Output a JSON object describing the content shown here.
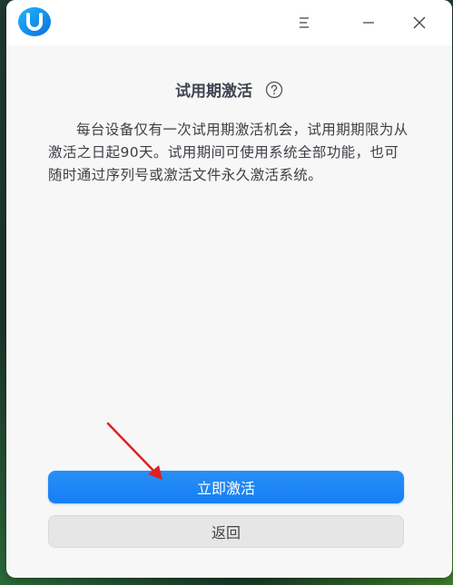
{
  "titlebar": {
    "app_icon": "uos-logo-icon",
    "menu_icon": "menu-icon",
    "minimize_icon": "minimize-icon",
    "close_icon": "close-icon"
  },
  "dialog": {
    "title": "试用期激活",
    "help_icon": "help-icon",
    "description": "每台设备仅有一次试用期激活机会，试用期期限为从激活之日起90天。试用期间可使用系统全部功能，也可随时通过序列号或激活文件永久激活系统。",
    "activate_button_label": "立即激活",
    "back_button_label": "返回"
  },
  "colors": {
    "primary": "#147ff5",
    "annotation_arrow": "#e02020"
  }
}
